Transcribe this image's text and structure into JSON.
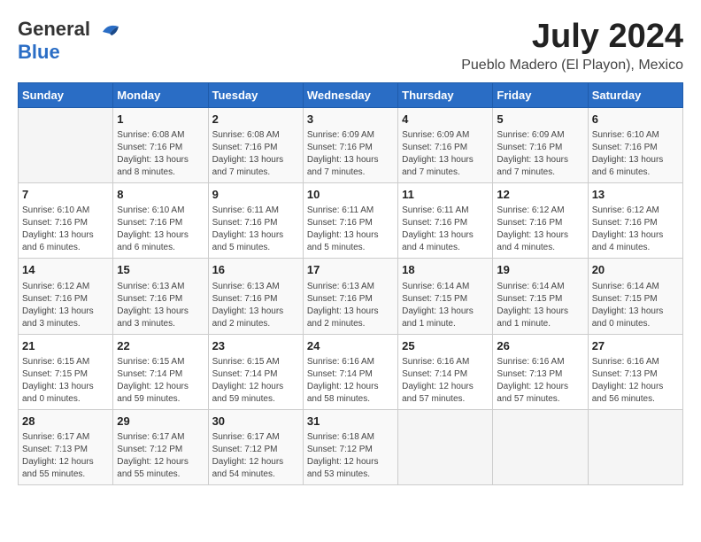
{
  "header": {
    "logo": {
      "general": "General",
      "blue": "Blue"
    },
    "title": "July 2024",
    "location": "Pueblo Madero (El Playon), Mexico"
  },
  "calendar": {
    "days_of_week": [
      "Sunday",
      "Monday",
      "Tuesday",
      "Wednesday",
      "Thursday",
      "Friday",
      "Saturday"
    ],
    "weeks": [
      [
        {
          "day": "",
          "info": ""
        },
        {
          "day": "1",
          "info": "Sunrise: 6:08 AM\nSunset: 7:16 PM\nDaylight: 13 hours\nand 8 minutes."
        },
        {
          "day": "2",
          "info": "Sunrise: 6:08 AM\nSunset: 7:16 PM\nDaylight: 13 hours\nand 7 minutes."
        },
        {
          "day": "3",
          "info": "Sunrise: 6:09 AM\nSunset: 7:16 PM\nDaylight: 13 hours\nand 7 minutes."
        },
        {
          "day": "4",
          "info": "Sunrise: 6:09 AM\nSunset: 7:16 PM\nDaylight: 13 hours\nand 7 minutes."
        },
        {
          "day": "5",
          "info": "Sunrise: 6:09 AM\nSunset: 7:16 PM\nDaylight: 13 hours\nand 7 minutes."
        },
        {
          "day": "6",
          "info": "Sunrise: 6:10 AM\nSunset: 7:16 PM\nDaylight: 13 hours\nand 6 minutes."
        }
      ],
      [
        {
          "day": "7",
          "info": "Sunrise: 6:10 AM\nSunset: 7:16 PM\nDaylight: 13 hours\nand 6 minutes."
        },
        {
          "day": "8",
          "info": "Sunrise: 6:10 AM\nSunset: 7:16 PM\nDaylight: 13 hours\nand 6 minutes."
        },
        {
          "day": "9",
          "info": "Sunrise: 6:11 AM\nSunset: 7:16 PM\nDaylight: 13 hours\nand 5 minutes."
        },
        {
          "day": "10",
          "info": "Sunrise: 6:11 AM\nSunset: 7:16 PM\nDaylight: 13 hours\nand 5 minutes."
        },
        {
          "day": "11",
          "info": "Sunrise: 6:11 AM\nSunset: 7:16 PM\nDaylight: 13 hours\nand 4 minutes."
        },
        {
          "day": "12",
          "info": "Sunrise: 6:12 AM\nSunset: 7:16 PM\nDaylight: 13 hours\nand 4 minutes."
        },
        {
          "day": "13",
          "info": "Sunrise: 6:12 AM\nSunset: 7:16 PM\nDaylight: 13 hours\nand 4 minutes."
        }
      ],
      [
        {
          "day": "14",
          "info": "Sunrise: 6:12 AM\nSunset: 7:16 PM\nDaylight: 13 hours\nand 3 minutes."
        },
        {
          "day": "15",
          "info": "Sunrise: 6:13 AM\nSunset: 7:16 PM\nDaylight: 13 hours\nand 3 minutes."
        },
        {
          "day": "16",
          "info": "Sunrise: 6:13 AM\nSunset: 7:16 PM\nDaylight: 13 hours\nand 2 minutes."
        },
        {
          "day": "17",
          "info": "Sunrise: 6:13 AM\nSunset: 7:16 PM\nDaylight: 13 hours\nand 2 minutes."
        },
        {
          "day": "18",
          "info": "Sunrise: 6:14 AM\nSunset: 7:15 PM\nDaylight: 13 hours\nand 1 minute."
        },
        {
          "day": "19",
          "info": "Sunrise: 6:14 AM\nSunset: 7:15 PM\nDaylight: 13 hours\nand 1 minute."
        },
        {
          "day": "20",
          "info": "Sunrise: 6:14 AM\nSunset: 7:15 PM\nDaylight: 13 hours\nand 0 minutes."
        }
      ],
      [
        {
          "day": "21",
          "info": "Sunrise: 6:15 AM\nSunset: 7:15 PM\nDaylight: 13 hours\nand 0 minutes."
        },
        {
          "day": "22",
          "info": "Sunrise: 6:15 AM\nSunset: 7:14 PM\nDaylight: 12 hours\nand 59 minutes."
        },
        {
          "day": "23",
          "info": "Sunrise: 6:15 AM\nSunset: 7:14 PM\nDaylight: 12 hours\nand 59 minutes."
        },
        {
          "day": "24",
          "info": "Sunrise: 6:16 AM\nSunset: 7:14 PM\nDaylight: 12 hours\nand 58 minutes."
        },
        {
          "day": "25",
          "info": "Sunrise: 6:16 AM\nSunset: 7:14 PM\nDaylight: 12 hours\nand 57 minutes."
        },
        {
          "day": "26",
          "info": "Sunrise: 6:16 AM\nSunset: 7:13 PM\nDaylight: 12 hours\nand 57 minutes."
        },
        {
          "day": "27",
          "info": "Sunrise: 6:16 AM\nSunset: 7:13 PM\nDaylight: 12 hours\nand 56 minutes."
        }
      ],
      [
        {
          "day": "28",
          "info": "Sunrise: 6:17 AM\nSunset: 7:13 PM\nDaylight: 12 hours\nand 55 minutes."
        },
        {
          "day": "29",
          "info": "Sunrise: 6:17 AM\nSunset: 7:12 PM\nDaylight: 12 hours\nand 55 minutes."
        },
        {
          "day": "30",
          "info": "Sunrise: 6:17 AM\nSunset: 7:12 PM\nDaylight: 12 hours\nand 54 minutes."
        },
        {
          "day": "31",
          "info": "Sunrise: 6:18 AM\nSunset: 7:12 PM\nDaylight: 12 hours\nand 53 minutes."
        },
        {
          "day": "",
          "info": ""
        },
        {
          "day": "",
          "info": ""
        },
        {
          "day": "",
          "info": ""
        }
      ]
    ]
  }
}
